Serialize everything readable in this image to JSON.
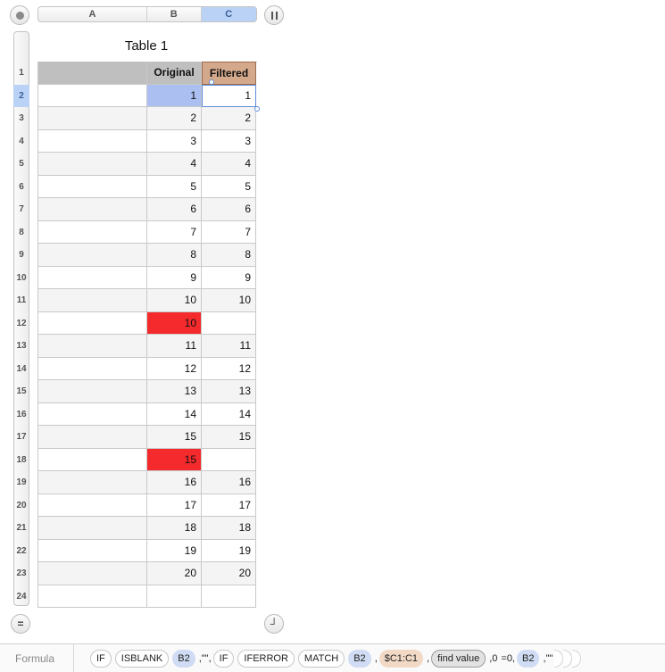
{
  "columns": {
    "headers": [
      "A",
      "B",
      "C"
    ],
    "selected": "C"
  },
  "table": {
    "title": "Table 1",
    "header_labels": {
      "a": "",
      "b": "Original",
      "c": "Filtered"
    }
  },
  "rows": {
    "numbers": [
      "1",
      "2",
      "3",
      "4",
      "5",
      "6",
      "7",
      "8",
      "9",
      "10",
      "11",
      "12",
      "13",
      "14",
      "15",
      "16",
      "17",
      "18",
      "19",
      "20",
      "21",
      "22",
      "23",
      "24"
    ],
    "selected_row": "2",
    "data": [
      {
        "a": "",
        "b": "1",
        "c": "1",
        "state": "selected"
      },
      {
        "a": "",
        "b": "2",
        "c": "2",
        "state": ""
      },
      {
        "a": "",
        "b": "3",
        "c": "3",
        "state": ""
      },
      {
        "a": "",
        "b": "4",
        "c": "4",
        "state": ""
      },
      {
        "a": "",
        "b": "5",
        "c": "5",
        "state": ""
      },
      {
        "a": "",
        "b": "6",
        "c": "6",
        "state": ""
      },
      {
        "a": "",
        "b": "7",
        "c": "7",
        "state": ""
      },
      {
        "a": "",
        "b": "8",
        "c": "8",
        "state": ""
      },
      {
        "a": "",
        "b": "9",
        "c": "9",
        "state": ""
      },
      {
        "a": "",
        "b": "10",
        "c": "10",
        "state": ""
      },
      {
        "a": "",
        "b": "10",
        "c": "",
        "state": "duplicate"
      },
      {
        "a": "",
        "b": "11",
        "c": "11",
        "state": ""
      },
      {
        "a": "",
        "b": "12",
        "c": "12",
        "state": ""
      },
      {
        "a": "",
        "b": "13",
        "c": "13",
        "state": ""
      },
      {
        "a": "",
        "b": "14",
        "c": "14",
        "state": ""
      },
      {
        "a": "",
        "b": "15",
        "c": "15",
        "state": ""
      },
      {
        "a": "",
        "b": "15",
        "c": "",
        "state": "duplicate"
      },
      {
        "a": "",
        "b": "16",
        "c": "16",
        "state": ""
      },
      {
        "a": "",
        "b": "17",
        "c": "17",
        "state": ""
      },
      {
        "a": "",
        "b": "18",
        "c": "18",
        "state": ""
      },
      {
        "a": "",
        "b": "19",
        "c": "19",
        "state": ""
      },
      {
        "a": "",
        "b": "20",
        "c": "20",
        "state": ""
      },
      {
        "a": "",
        "b": "",
        "c": "",
        "state": ""
      }
    ]
  },
  "colors": {
    "duplicate_fill": "#f42a2c",
    "selection_fill": "#abbff0",
    "header_fill": "#bfbfbf",
    "filtered_header_fill": "#d4a98b"
  },
  "formula_bar": {
    "label": "Formula",
    "tokens": [
      {
        "text": "IF",
        "kind": "fn"
      },
      {
        "text": "ISBLANK",
        "kind": "fn"
      },
      {
        "text": "B2",
        "kind": "ref"
      },
      {
        "text": ",\"\",",
        "kind": "lit"
      },
      {
        "text": "IF",
        "kind": "fn"
      },
      {
        "text": "IFERROR",
        "kind": "fn"
      },
      {
        "text": "MATCH",
        "kind": "fn"
      },
      {
        "text": "B2",
        "kind": "ref"
      },
      {
        "text": ",",
        "kind": "lit"
      },
      {
        "text": "$C1:C1",
        "kind": "ref2"
      },
      {
        "text": ",",
        "kind": "lit"
      },
      {
        "text": "find value",
        "kind": "str"
      },
      {
        "text": ",0",
        "kind": "lit"
      },
      {
        "text": "=0,",
        "kind": "lit"
      },
      {
        "text": "B2",
        "kind": "ref"
      },
      {
        "text": ",\"\"",
        "kind": "lit"
      }
    ]
  },
  "icons": {
    "corner": "circle-select-icon",
    "pause": "pause-icon",
    "add_rows": "equals-icon",
    "resize": "resize-corner-icon"
  }
}
